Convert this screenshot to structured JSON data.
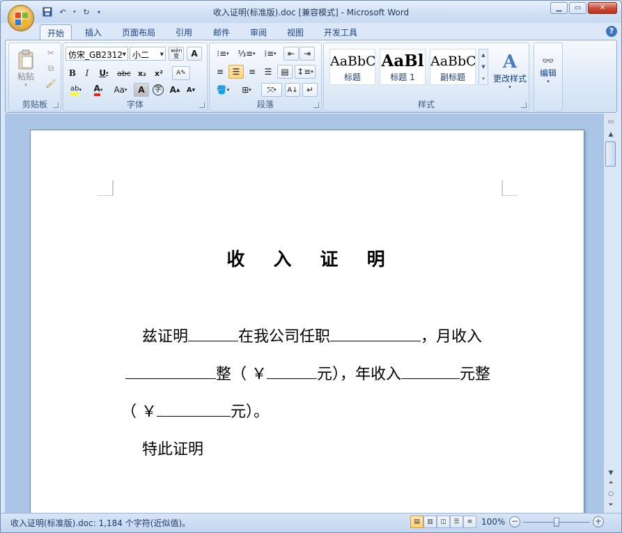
{
  "window": {
    "title": "收入证明(标准版).doc [兼容模式] - Microsoft Word"
  },
  "tabs": [
    "开始",
    "插入",
    "页面布局",
    "引用",
    "邮件",
    "审阅",
    "视图",
    "开发工具"
  ],
  "ribbon": {
    "clipboard": {
      "paste_label": "粘贴",
      "group_label": "剪贴板"
    },
    "font": {
      "font_name": "仿宋_GB2312",
      "font_size": "小二",
      "group_label": "字体",
      "phonetic_label": "wén 变"
    },
    "paragraph": {
      "group_label": "段落"
    },
    "styles": {
      "group_label": "样式",
      "cards": [
        {
          "sample": "AaBbC",
          "name": "标题"
        },
        {
          "sample": "AaBl",
          "name": "标题 1"
        },
        {
          "sample": "AaBbC",
          "name": "副标题"
        }
      ],
      "change_styles": "更改样式"
    },
    "editing": {
      "label": "编辑"
    }
  },
  "document": {
    "title": "收 入 证 明",
    "line1": {
      "a": "兹证明",
      "b": "在我公司任职",
      "c": "，月收入"
    },
    "line2": {
      "a": "整（ ￥",
      "b": "元），年收入",
      "c": "元整"
    },
    "line3": {
      "a": "（ ￥",
      "b": "元）。"
    },
    "line4": "特此证明"
  },
  "status": {
    "text": "收入证明(标准版).doc: 1,184 个字符(近似值)。",
    "zoom": "100%"
  }
}
